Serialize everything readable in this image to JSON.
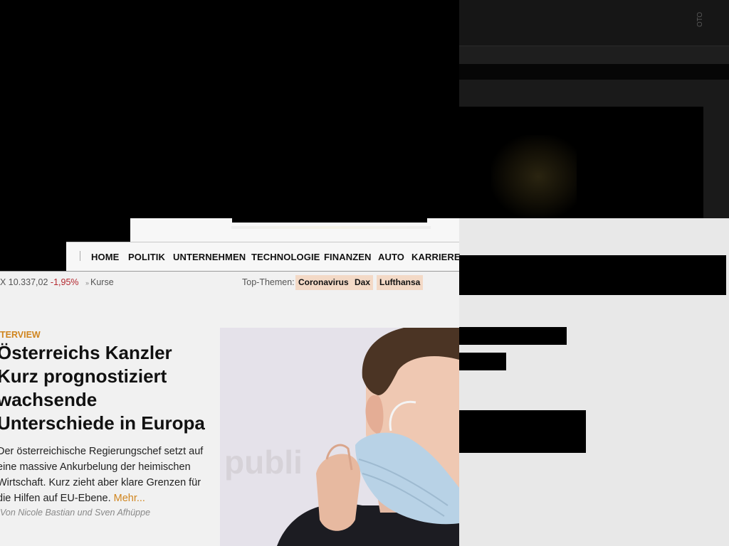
{
  "overlay": {
    "vertical_label": "ОТО"
  },
  "nav": {
    "items": [
      "HOME",
      "POLITIK",
      "UNTERNEHMEN",
      "TECHNOLOGIE",
      "FINANZEN",
      "AUTO",
      "KARRIERE"
    ]
  },
  "ticker": {
    "index": "X 10.337,02",
    "change": "-1,95%",
    "link": "Kurse"
  },
  "topics": {
    "label": "Top-Themen:",
    "tags": [
      "Coronavirus",
      "Dax",
      "Lufthansa"
    ]
  },
  "article": {
    "kicker": "TERVIEW",
    "headline": "Österreichs Kanzler Kurz prognostiziert wachsende Unterschiede in Europa",
    "headline_lines": [
      "Österreichs Kanzler",
      "Kurz prognostiziert",
      "wachsende",
      "Unterschiede in Europa"
    ],
    "teaser_lines": [
      "Der österreichische Regierungschef setzt auf",
      "eine massive Ankurbelung der heimischen",
      "Wirtschaft. Kurz zieht aber klare Grenzen für",
      "die Hilfen auf EU-Ebene."
    ],
    "more": "Mehr...",
    "author": "Von Nicole Bastian und Sven Afhüppe"
  },
  "photo": {
    "watermark": "publi"
  },
  "colors": {
    "accent": "#d0851e",
    "negative": "#b3262d",
    "tag_bg": "#f3d9c6"
  }
}
